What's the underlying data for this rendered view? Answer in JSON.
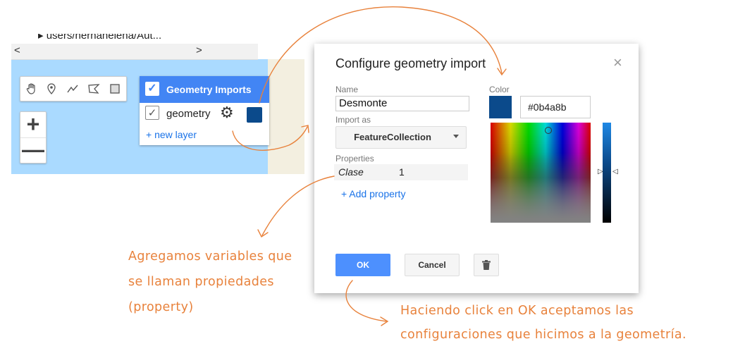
{
  "map": {
    "path_text": "▸ users/hernanelena/Aut...",
    "scroll_left": "<",
    "scroll_right": ">",
    "tools": [
      "hand-icon",
      "marker-icon",
      "line-icon",
      "polygon-icon",
      "rectangle-icon"
    ],
    "zoom_in": "+",
    "zoom_out": "—"
  },
  "geometry_imports": {
    "title": "Geometry Imports",
    "layer_name": "geometry",
    "layer_color": "#0b4a8b",
    "new_layer": "+ new layer"
  },
  "dialog": {
    "title": "Configure geometry import",
    "close": "×",
    "name_label": "Name",
    "name_value": "Desmonte",
    "import_label": "Import as",
    "import_value": "FeatureCollection",
    "properties_label": "Properties",
    "property_key": "Clase",
    "property_value": "1",
    "add_property": "+ Add property",
    "color_label": "Color",
    "color_hex": "#0b4a8b",
    "ok": "OK",
    "cancel": "Cancel"
  },
  "annotations": {
    "note1_line1": "Agregamos variables que",
    "note1_line2": "se llaman propiedades",
    "note1_line3": "(property)",
    "note2_line1": "Haciendo click en OK aceptamos las",
    "note2_line2": "configuraciones que hicimos a la geometría."
  },
  "colors": {
    "accent": "#4285f4",
    "annotation": "#e8823c",
    "selected_color": "#0b4a8b"
  }
}
